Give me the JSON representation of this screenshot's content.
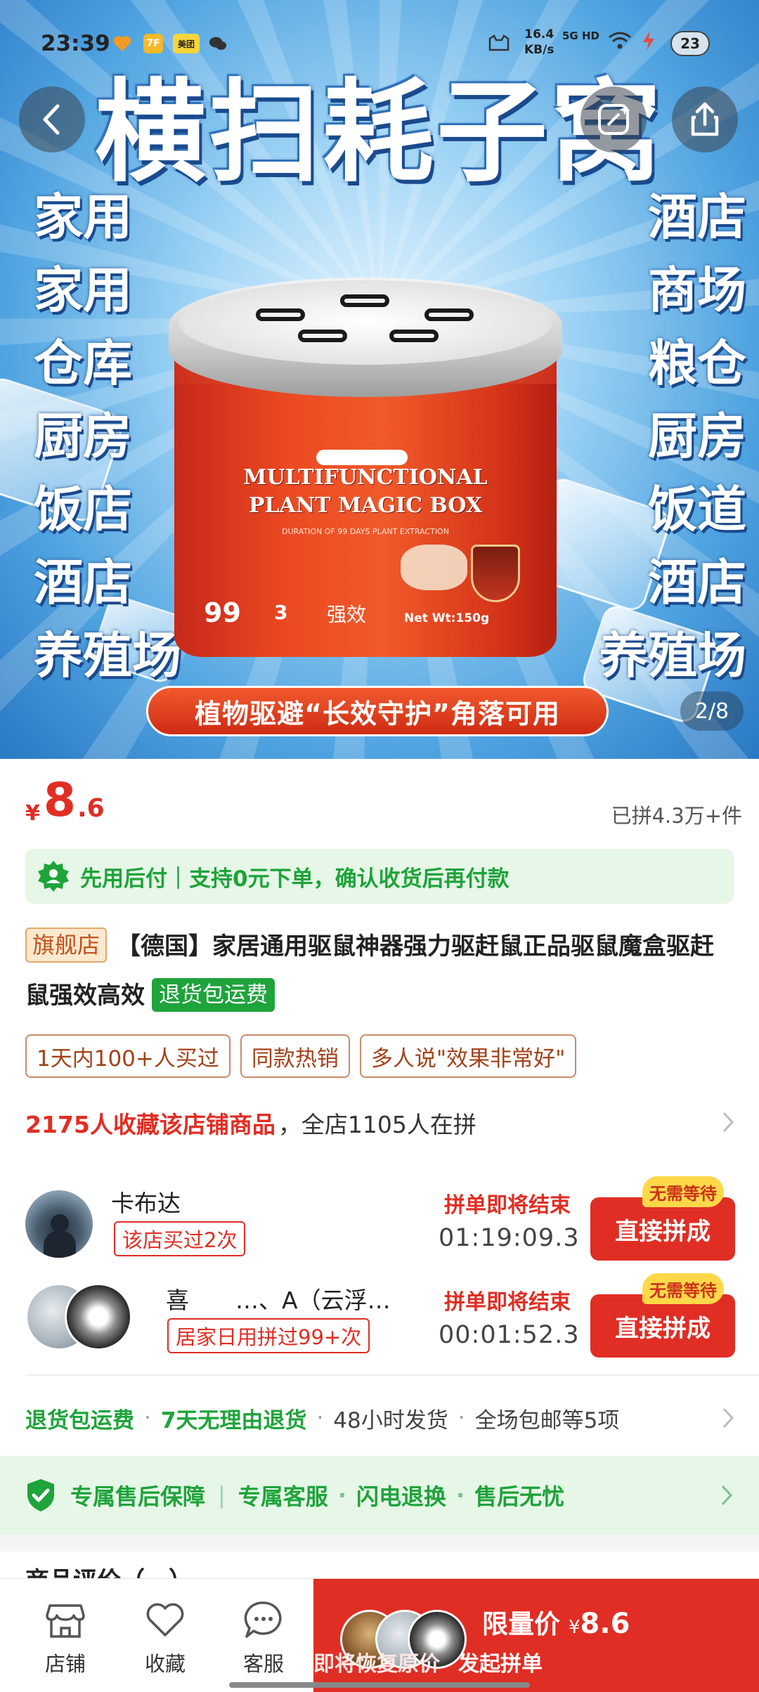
{
  "status_bar": {
    "time": "23:39",
    "net_speed_value": "16.4",
    "net_speed_unit": "KB/s",
    "signal": "5G HD",
    "battery": "23",
    "app_badges": [
      "7F",
      "美团"
    ]
  },
  "hero": {
    "title": "横扫耗子窝",
    "left_words": [
      "家用",
      "家用",
      "仓库",
      "厨房",
      "饭店",
      "酒店",
      "养殖场"
    ],
    "right_words": [
      "酒店",
      "商场",
      "粮仓",
      "厨房",
      "饭道",
      "酒店",
      "养殖场"
    ],
    "product_line1": "MULTIFUNCTIONAL",
    "product_line2": "PLANT MAGIC BOX",
    "product_sub": "DURATION OF 99 DAYS PLANT EXTRACTION",
    "product_num1": "99",
    "product_num2": "3",
    "product_strong": "强效",
    "product_netwt": "Net Wt:150g",
    "banner": "植物驱避“长效守护”角落可用",
    "pager": "2/8"
  },
  "price": {
    "currency": "¥",
    "integer": "8",
    "decimal": ".6",
    "sold": "已拼4.3万+件"
  },
  "pay_later": {
    "text": "先用后付｜支持0元下单，确认收货后再付款"
  },
  "product": {
    "shop_tag": "旗舰店",
    "title": "【德国】家居通用驱鼠神器强力驱赶鼠正品驱鼠魔盒驱赶鼠强效高效",
    "return_tag": "退货包运费",
    "chips": [
      "1天内100+人买过",
      "同款热销",
      "多人说\"效果非常好\""
    ]
  },
  "collect": {
    "highlight": "2175人收藏该店铺商品",
    "rest": "，全店1105人在拼"
  },
  "groups": [
    {
      "name": "卡布达",
      "tag": "该店买过2次",
      "ending": "拼单即将结束",
      "timer": "01:19:09.3",
      "button": "直接拼成",
      "badge": "无需等待"
    },
    {
      "name": "喜　　…、A（云浮…",
      "tag": "居家日用拼过99+次",
      "ending": "拼单即将结束",
      "timer": "00:01:52.3",
      "button": "直接拼成",
      "badge": "无需等待"
    }
  ],
  "services": {
    "green": [
      "退货包运费",
      "7天无理由退货"
    ],
    "grey": [
      "48小时发货",
      "全场包邮等5项"
    ]
  },
  "guarantee": {
    "items": [
      "专属售后保障",
      "专属客服",
      "闪电退换",
      "售后无忧"
    ]
  },
  "peek_text": "商品评价（…）",
  "bottom_bar": {
    "tabs": [
      "店铺",
      "收藏",
      "客服"
    ],
    "limit_label": "限量价",
    "limit_currency": "¥",
    "limit_price": "8.6",
    "restore": "即将恢复原价",
    "start_group": "发起拼单"
  },
  "colors": {
    "accent_red": "#e02e24",
    "green": "#1fa33b",
    "green_bg": "#e6f6e7"
  }
}
